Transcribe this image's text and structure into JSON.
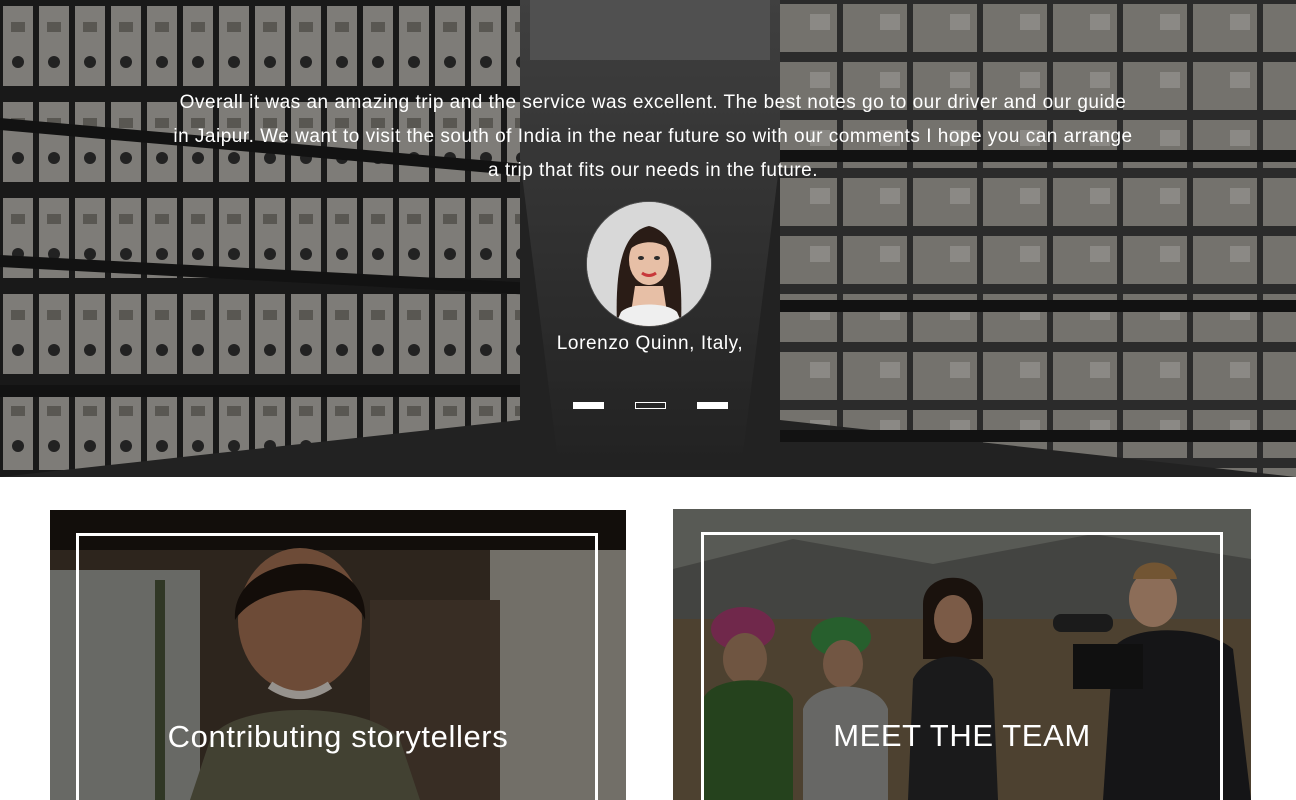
{
  "testimonial": {
    "quote": "Overall it was an amazing trip and the service was excellent. The best notes go to our driver and our guide in Jaipur. We want to visit the south of India in the near future so with our comments I hope you can arrange a trip that fits our needs in the future.",
    "author": "Lorenzo Quinn, Italy,",
    "slides": [
      {
        "style": "filled"
      },
      {
        "style": "outline",
        "active": true
      },
      {
        "style": "filled"
      }
    ]
  },
  "cards": {
    "left": {
      "title": "Contributing storytellers"
    },
    "right": {
      "title": "MEET THE TEAM"
    }
  },
  "colors": {
    "text": "#ffffff",
    "page_background": "#ffffff",
    "overlay": "#000000"
  }
}
